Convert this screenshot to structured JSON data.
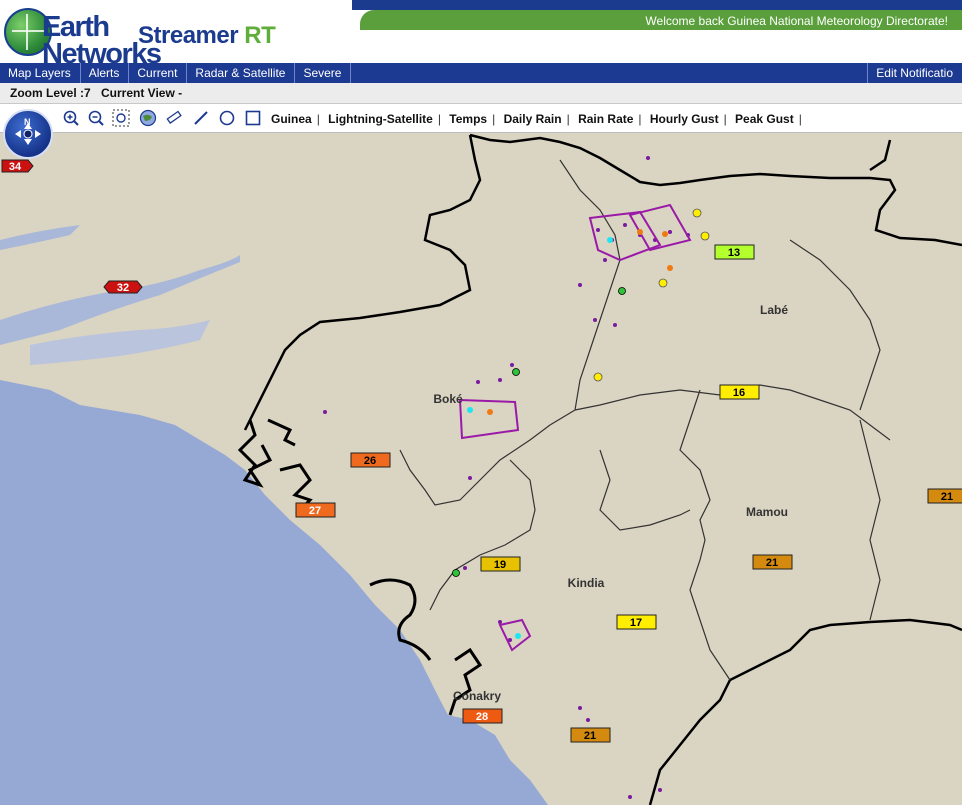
{
  "header": {
    "brand_line1": "Earth",
    "brand_line2": "Networks",
    "product": "Streamer",
    "product_suffix": "RT",
    "welcome": "Welcome back  Guinea National Meteorology Directorate!"
  },
  "nav": {
    "items": [
      "Map Layers",
      "Alerts",
      "Current",
      "Radar & Satellite",
      "Severe"
    ],
    "edit_notifications": "Edit Notificatio"
  },
  "zoom": {
    "label": "Zoom Level :",
    "value": "7",
    "view_label": "Current View -"
  },
  "toolbar": {
    "tools": [
      "zoom-in-icon",
      "zoom-out-icon",
      "zoom-box-icon",
      "globe-icon",
      "ruler-icon",
      "line-icon",
      "circle-icon",
      "rectangle-icon"
    ],
    "layers": [
      "Guinea",
      "Lightning-Satellite",
      "Temps",
      "Daily Rain",
      "Rain Rate",
      "Hourly Gust",
      "Peak Gust"
    ]
  },
  "map": {
    "cities": [
      "Labé",
      "Boké",
      "Mamou",
      "Kindia",
      "Conakry"
    ],
    "temps": [
      {
        "value": "34",
        "color": "#cc1111"
      },
      {
        "value": "32",
        "color": "#cc1111"
      },
      {
        "value": "13",
        "color": "#b4ff2e"
      },
      {
        "value": "16",
        "color": "#ffee00"
      },
      {
        "value": "26",
        "color": "#ef6a1e"
      },
      {
        "value": "27",
        "color": "#ef6a1e"
      },
      {
        "value": "19",
        "color": "#e8c200"
      },
      {
        "value": "21",
        "color": "#d48a0e"
      },
      {
        "value": "17",
        "color": "#ffee00"
      },
      {
        "value": "28",
        "color": "#ef5a12"
      },
      {
        "value": "21",
        "color": "#d48a0e"
      },
      {
        "value": "21",
        "color": "#d48a0e"
      }
    ],
    "colors": {
      "land": "#dad4c2",
      "ocean": "#96a8d4",
      "border": "#000000",
      "lightning": "#7a1aa0",
      "storm_cell": "#9a1aa8"
    }
  }
}
